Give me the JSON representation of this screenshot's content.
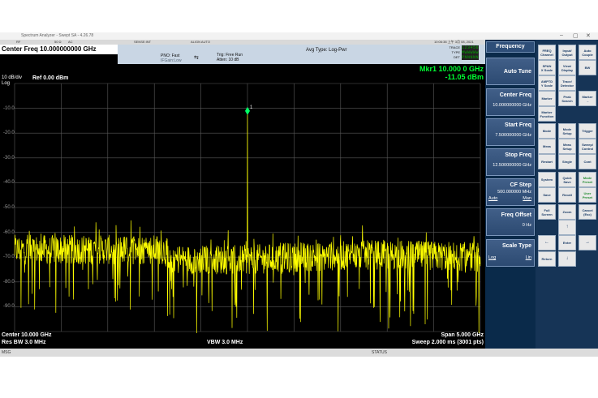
{
  "window": {
    "title": "Spectrum Analyzer - Swept SA - 4.26.78",
    "controls": [
      "–",
      "▢",
      "✕"
    ]
  },
  "topbar": {
    "tabs": [
      "RF",
      "50 Ω",
      "AC",
      "SENSE:INT",
      "ALIGN AUTO"
    ],
    "datetime": "10:06:38 上午 3月 08, 2021",
    "center_freq_label": "Center Freq 10.000000000 GHz",
    "pno": "PNO: Fast",
    "if_gain": "IFGain:Low",
    "trig": "Trig: Free Run",
    "atten": "Atten: 10 dB",
    "avg_type": "Avg Type: Log-Pwr",
    "trace_rows": [
      {
        "label": "TRACE",
        "value": "123456"
      },
      {
        "label": "TYPE",
        "value": "MWWWWW"
      },
      {
        "label": "DET",
        "value": "PNNNNN"
      }
    ]
  },
  "display": {
    "marker_line1": "Mkr1 10.000 0 GHz",
    "marker_line2": "-11.05 dBm",
    "scale_line1": "10 dB/div",
    "scale_line2": "Log",
    "ref_level": "Ref 0.00 dBm",
    "marker_tag": "1",
    "y_tick_labels": [
      "-10.0",
      "-20.0",
      "-30.0",
      "-40.0",
      "-50.0",
      "-60.0",
      "-70.0",
      "-80.0",
      "-90.0"
    ]
  },
  "chart_data": {
    "type": "line",
    "x_range_ghz": [
      7.5,
      12.5
    ],
    "ylim": [
      0,
      -100
    ],
    "noise_floor_dbm": [
      {
        "x_ghz": 7.5,
        "mean": -67
      },
      {
        "x_ghz": 9.1,
        "mean": -67
      },
      {
        "x_ghz": 9.2,
        "mean": -71
      },
      {
        "x_ghz": 10.0,
        "mean": -71
      },
      {
        "x_ghz": 10.5,
        "mean": -70
      },
      {
        "x_ghz": 11.5,
        "mean": -69
      },
      {
        "x_ghz": 12.5,
        "mean": -70
      }
    ],
    "peak": {
      "x_ghz": 10.0,
      "y_dbm": -11.05
    },
    "trace_color": "#ffff00",
    "grid": true
  },
  "footer": {
    "center": "Center 10.000 GHz",
    "res_bw": "Res BW 3.0 MHz",
    "vbw": "VBW 3.0 MHz",
    "span": "Span 5.000 GHz",
    "sweep": "Sweep  2.000 ms (3001 pts)"
  },
  "statusbar": {
    "msg": "MSG",
    "status": "STATUS"
  },
  "softkeys": {
    "title": "Frequency",
    "items": [
      {
        "label": "Auto Tune",
        "value": "",
        "sub_left": "",
        "sub_right": ""
      },
      {
        "label": "Center Freq",
        "value": "10.000000000 GHz",
        "sub_left": "",
        "sub_right": ""
      },
      {
        "label": "Start Freq",
        "value": "7.500000000 GHz",
        "sub_left": "",
        "sub_right": ""
      },
      {
        "label": "Stop Freq",
        "value": "12.500000000 GHz",
        "sub_left": "",
        "sub_right": ""
      },
      {
        "label": "CF Step",
        "value": "500.000000 MHz",
        "sub_left": "Auto",
        "sub_right": "Man"
      },
      {
        "label": "Freq Offset",
        "value": "0 Hz",
        "sub_left": "",
        "sub_right": ""
      },
      {
        "label": "Scale Type",
        "value": "",
        "sub_left": "Log",
        "sub_right": "Lin"
      }
    ]
  },
  "hardkeys": {
    "freq_channel": "FREQ\nChannel",
    "input_output": "Input/\nOutput",
    "auto_couple": "Auto\nCouple",
    "span_xscale": "SPAN\nX Scale",
    "view_display": "View/\nDisplay",
    "bw": "BW",
    "amptd_yscale": "AMPTD\nY Scale",
    "trace_detector": "Trace/\nDetector",
    "marker": "Marker",
    "peak_search": "Peak\nSearch",
    "marker_arrow": "Marker\n→",
    "marker_function": "Marker\nFunction",
    "mode": "Mode",
    "mode_setup": "Mode\nSetup",
    "trigger": "Trigger",
    "meas": "Meas",
    "meas_setup": "Meas\nSetup",
    "sweep_control": "Sweep/\nControl",
    "restart": "Restart",
    "single": "Single",
    "cont": "Cont",
    "system": "System",
    "quick_save": "Quick\nSave",
    "mode_preset": "Mode\nPreset",
    "save": "Save",
    "recall": "Recall",
    "user_preset": "User\nPreset",
    "full_screen": "Full\nScreen",
    "zoom": "Zoom",
    "cancel_esc": "Cancel\n(Esc)",
    "up": "↑",
    "left": "←",
    "enter": "Enter",
    "right": "→",
    "return": "Return",
    "down": "↓"
  }
}
